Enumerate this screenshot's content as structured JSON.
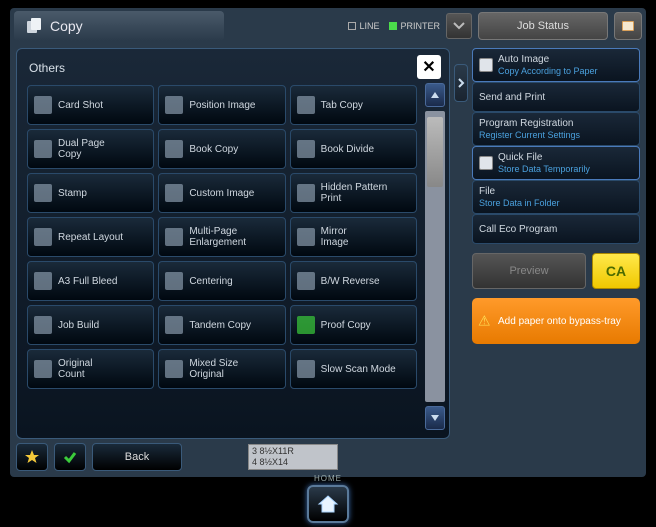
{
  "header": {
    "title": "Copy",
    "line_label": "LINE",
    "printer_label": "PRINTER",
    "job_status": "Job Status"
  },
  "panel": {
    "title": "Others"
  },
  "functions": [
    {
      "label": "Card Shot"
    },
    {
      "label": "Position Image"
    },
    {
      "label": "Tab Copy"
    },
    {
      "label": "Dual Page\nCopy"
    },
    {
      "label": "Book Copy"
    },
    {
      "label": "Book Divide"
    },
    {
      "label": "Stamp"
    },
    {
      "label": "Custom Image"
    },
    {
      "label": "Hidden Pattern\nPrint"
    },
    {
      "label": "Repeat Layout"
    },
    {
      "label": "Multi-Page\nEnlargement"
    },
    {
      "label": "Mirror\nImage"
    },
    {
      "label": "A3 Full Bleed"
    },
    {
      "label": "Centering"
    },
    {
      "label": "B/W Reverse"
    },
    {
      "label": "Job Build"
    },
    {
      "label": "Tandem Copy"
    },
    {
      "label": "Proof Copy",
      "checked": true
    },
    {
      "label": "Original\nCount"
    },
    {
      "label": "Mixed Size\nOriginal"
    },
    {
      "label": "Slow Scan Mode"
    }
  ],
  "side": {
    "items": [
      {
        "title": "Auto Image",
        "sub": "Copy According to Paper",
        "box": true
      },
      {
        "title": "Send and Print"
      },
      {
        "title": "Program Registration",
        "sub": "Register Current Settings"
      },
      {
        "title": "Quick File",
        "sub": "Store Data Temporarily",
        "box": true
      },
      {
        "title": "File",
        "sub": "Store Data in Folder"
      },
      {
        "title": "Call Eco Program"
      }
    ],
    "preview": "Preview",
    "ca": "CA",
    "warning": "Add paper onto bypass-tray"
  },
  "bottom": {
    "back": "Back",
    "tray_line1": "3  8½X11R",
    "tray_line2": "4  8½X14"
  },
  "home": "HOME"
}
